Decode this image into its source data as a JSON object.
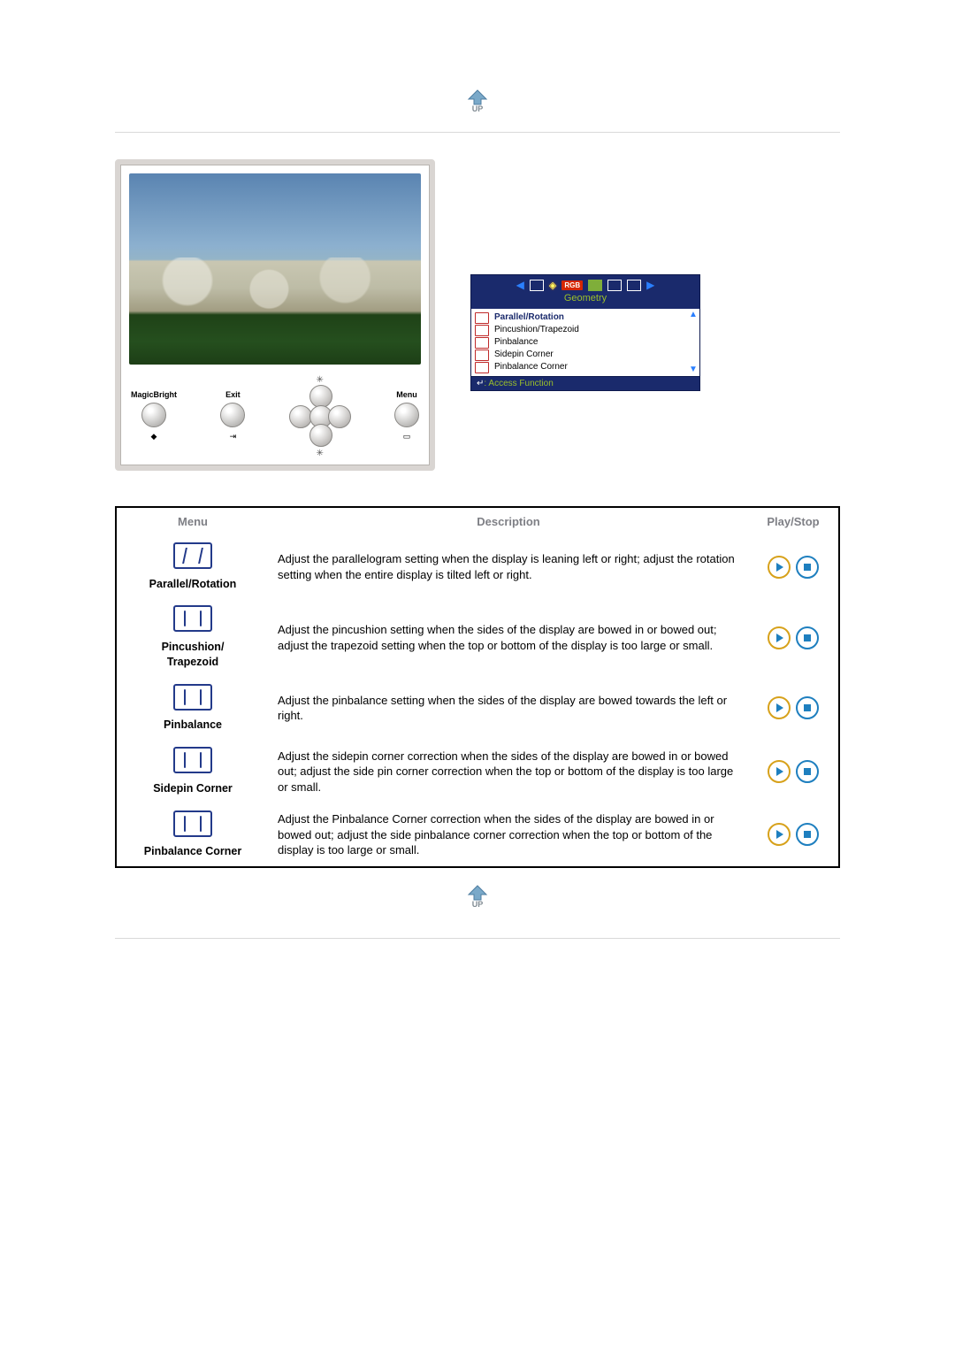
{
  "monitor": {
    "buttons": {
      "left_label": "MagicBright",
      "exit_label": "Exit",
      "menu_label": "Menu"
    }
  },
  "osd": {
    "title": "Geometry",
    "rgb_badge": "RGB",
    "items": [
      "Parallel/Rotation",
      "Pincushion/Trapezoid",
      "Pinbalance",
      "Sidepin Corner",
      "Pinbalance Corner"
    ],
    "footer_symbol": "↵",
    "footer_text": ": Access Function"
  },
  "table": {
    "headers": {
      "menu": "Menu",
      "description": "Description",
      "playstop": "Play/Stop"
    },
    "rows": [
      {
        "name": "Parallel/Rotation",
        "description": "Adjust the parallelogram setting when the display is leaning left or right; adjust the rotation setting when the entire display is tilted left or right."
      },
      {
        "name": "Pincushion/\nTrapezoid",
        "description": "Adjust the pincushion setting when the sides of the display are bowed in or bowed out; adjust the trapezoid setting when the top or bottom of the display is too large or small."
      },
      {
        "name": "Pinbalance",
        "description": "Adjust the pinbalance setting when the sides of the display are bowed towards the left or right."
      },
      {
        "name": "Sidepin Corner",
        "description": "Adjust the sidepin corner correction when the sides of the display are bowed in or bowed out; adjust the side pin corner correction when the top or bottom of the display is too large or small."
      },
      {
        "name": "Pinbalance Corner",
        "description": "Adjust the Pinbalance Corner correction when the sides of the display are bowed in or bowed out; adjust the side pinbalance corner correction when the top or bottom of the display is too large or small."
      }
    ]
  },
  "up_label": "UP"
}
